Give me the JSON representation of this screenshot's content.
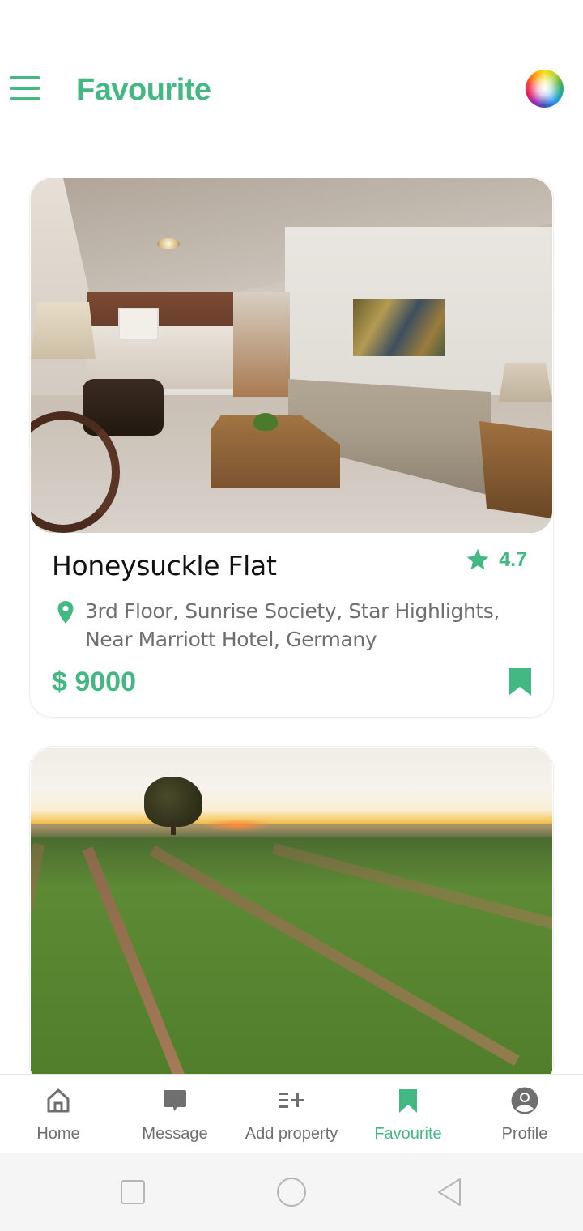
{
  "header": {
    "title": "Favourite",
    "menu_icon": "hamburger-menu-icon",
    "theme_icon": "color-wheel-icon"
  },
  "colors": {
    "accent": "#43b883",
    "text_primary": "#111111",
    "text_secondary": "#6f6f6f",
    "icon_inactive": "#6f6f6f",
    "system_nav_bg": "#f5f5f5"
  },
  "properties": [
    {
      "name": "Honeysuckle Flat",
      "rating": "4.7",
      "address": "3rd Floor, Sunrise Society, Star Highlights, Near Marriott Hotel, Germany",
      "price": "$ 9000",
      "image": "living-room-photo",
      "bookmarked": true
    },
    {
      "image": "farmland-sunset-photo"
    }
  ],
  "bottom_nav": {
    "items": [
      {
        "label": "Home",
        "icon": "home-icon",
        "active": false
      },
      {
        "label": "Message",
        "icon": "message-icon",
        "active": false
      },
      {
        "label": "Add property",
        "icon": "add-list-icon",
        "active": false
      },
      {
        "label": "Favourite",
        "icon": "bookmark-icon",
        "active": true
      },
      {
        "label": "Profile",
        "icon": "profile-icon",
        "active": false
      }
    ]
  },
  "system_nav": {
    "buttons": [
      "recent-apps",
      "home",
      "back"
    ]
  }
}
